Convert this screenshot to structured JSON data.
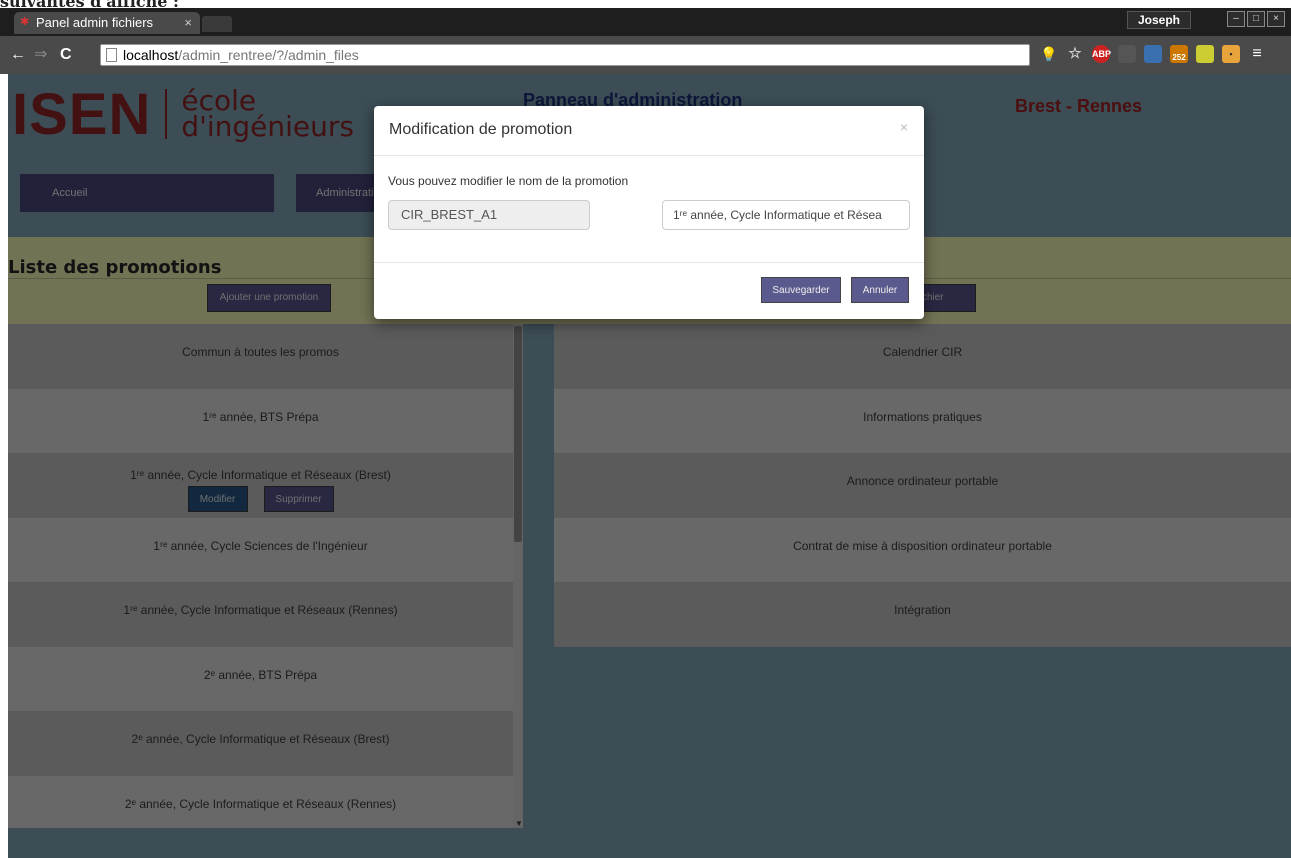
{
  "caption": "suivantes d'affiche :",
  "browser": {
    "tab_title": "Panel admin fichiers",
    "tab_close": "×",
    "user": "Joseph",
    "url_host": "localhost",
    "url_path": "/admin_rentree/?/admin_files",
    "ext_abp": "ABP",
    "ext_badge": "252"
  },
  "site": {
    "logo_main": "ISEN",
    "logo_sub_line1": "école",
    "logo_sub_line2": "d'ingénieurs",
    "title": "Panneau d'administration",
    "city": "Brest - Rennes"
  },
  "menu": {
    "home": "Accueil",
    "admin": "Administration"
  },
  "promotions": {
    "title": "Liste des promotions",
    "add_button": "Ajouter une promotion",
    "modify_button": "Modifier",
    "delete_button": "Supprimer",
    "items": [
      "Commun à toutes les promos",
      "1ʳᵉ année, BTS Prépa",
      "1ʳᵉ année, Cycle Informatique et Réseaux (Brest)",
      "1ʳᵉ année, Cycle Sciences de l'Ingénieur",
      "1ʳᵉ année, Cycle Informatique et Réseaux (Rennes)",
      "2ᵉ année, BTS Prépa",
      "2ᵉ année, Cycle Informatique et Réseaux (Brest)",
      "2ᵉ année, Cycle Informatique et Réseaux (Rennes)"
    ]
  },
  "files": {
    "add_button": "n fichier",
    "items": [
      "Calendrier CIR",
      "Informations pratiques",
      "Annonce ordinateur portable",
      "Contrat de mise à disposition ordinateur portable",
      "Intégration"
    ]
  },
  "modal": {
    "title": "Modification de promotion",
    "close": "×",
    "text": "Vous pouvez modifier le nom de la promotion",
    "code_value": "CIR_BREST_A1",
    "name_value": "1ʳᵉ année, Cycle Informatique et Résea",
    "save": "Sauvegarder",
    "cancel": "Annuler"
  }
}
